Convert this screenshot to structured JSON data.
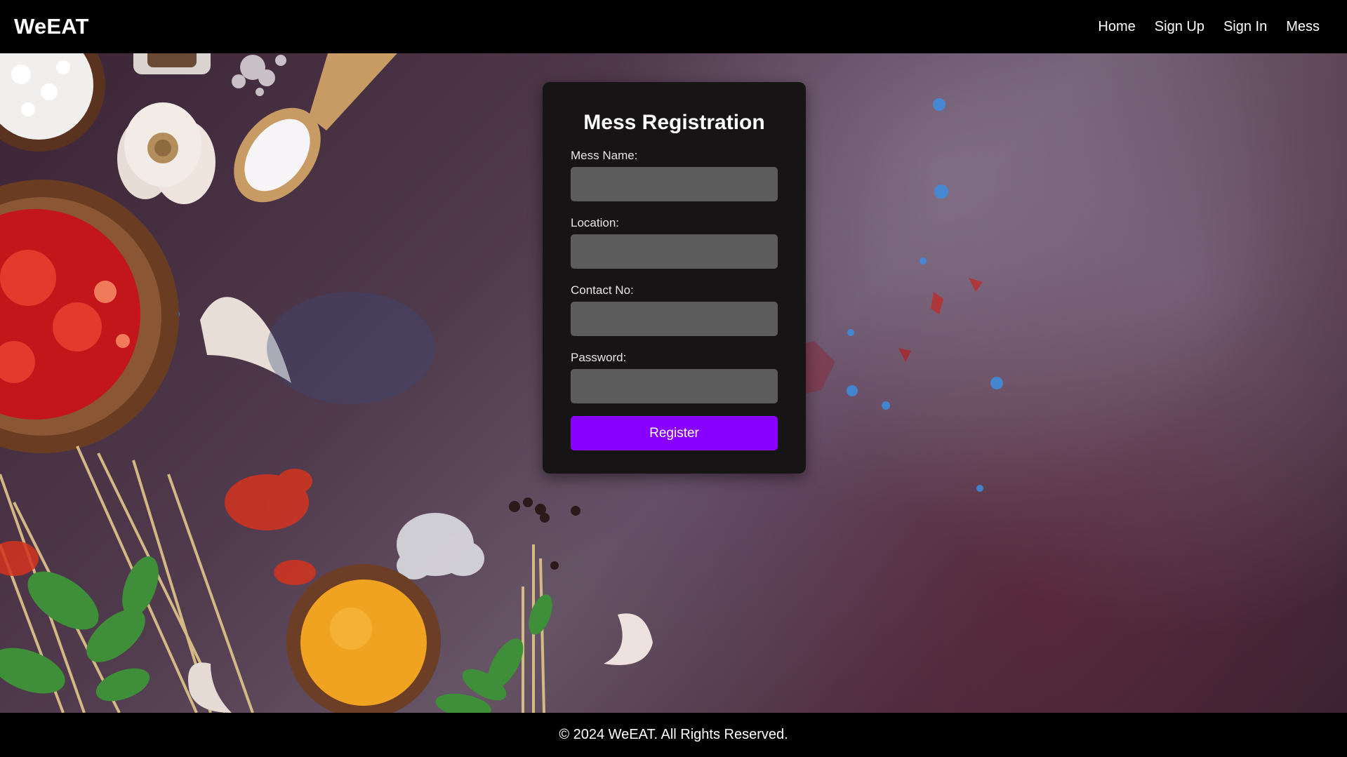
{
  "header": {
    "brand": "WeEAT",
    "nav": [
      {
        "label": "Home"
      },
      {
        "label": "Sign Up"
      },
      {
        "label": "Sign In"
      },
      {
        "label": "Mess"
      }
    ]
  },
  "form": {
    "title": "Mess Registration",
    "fields": [
      {
        "label": "Mess Name:",
        "value": "",
        "placeholder": ""
      },
      {
        "label": "Location:",
        "value": "",
        "placeholder": ""
      },
      {
        "label": "Contact No:",
        "value": "",
        "placeholder": ""
      },
      {
        "label": "Password:",
        "value": "",
        "placeholder": ""
      }
    ],
    "submit_label": "Register"
  },
  "footer": {
    "text": "© 2024 WeEAT. All Rights Reserved."
  },
  "colors": {
    "accent": "#8800ff",
    "card_background": "#161414",
    "input_background": "#5c5c5c",
    "bars": "#000000"
  },
  "background": {
    "image": "food-spices-on-dark-surface"
  }
}
